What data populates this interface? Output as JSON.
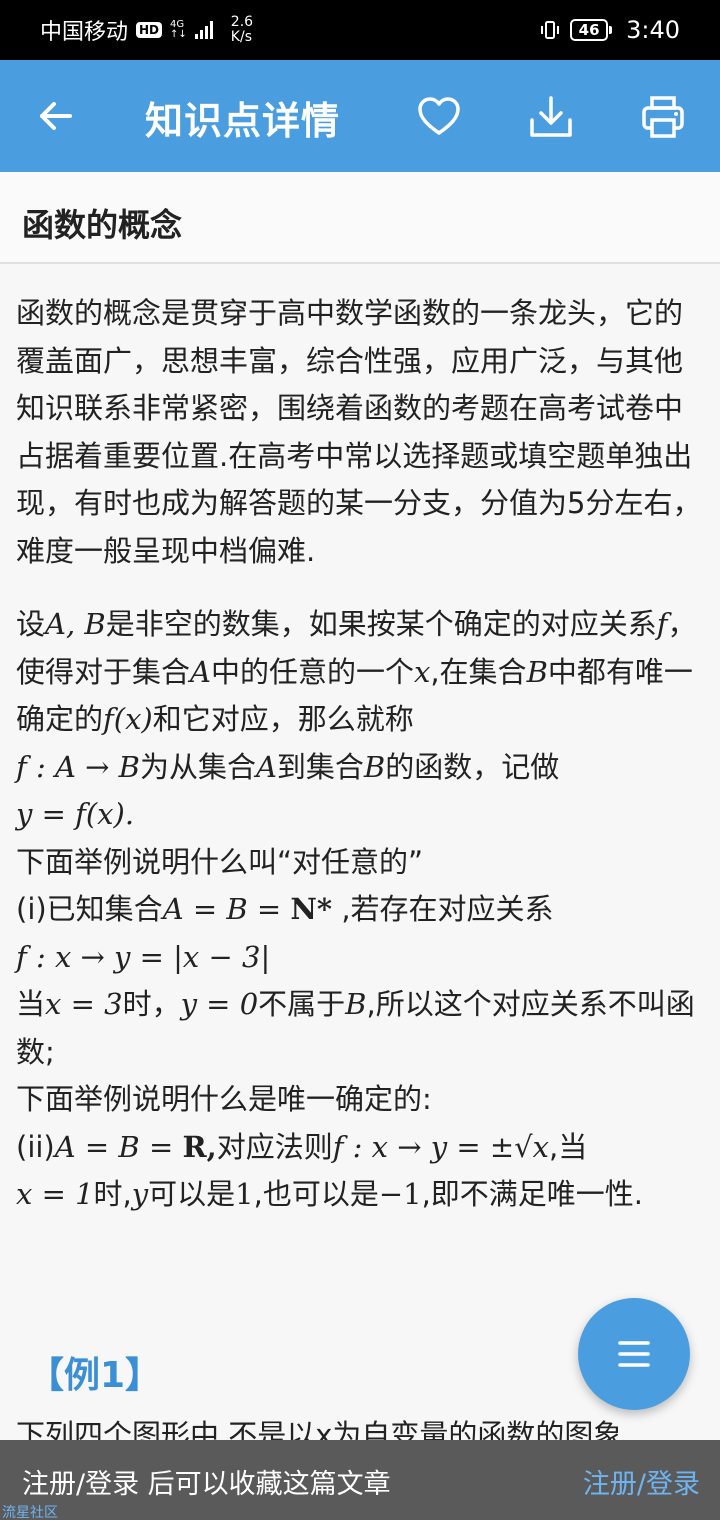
{
  "status_bar": {
    "carrier": "中国移动",
    "hd": "HD",
    "net_type_top": "4G",
    "net_type_bottom": "↑↓",
    "speed_value": "2.6",
    "speed_unit": "K/s",
    "battery": "46",
    "time": "3:40"
  },
  "app_bar": {
    "title": "知识点详情"
  },
  "section": {
    "title": "函数的概念"
  },
  "content": {
    "intro": "函数的概念是贯穿于高中数学函数的一条龙头，它的覆盖面广，思想丰富，综合性强，应用广泛，与其他知识联系非常紧密，围绕着函数的考题在高考试卷中占据着重要位置.在高考中常以选择题或填空题单独出现，有时也成为解答题的某一分支，分值为5分左右，难度一般呈现中档偏难.",
    "def_1": "设",
    "def_m1": "A, B",
    "def_2": "是非空的数集，如果按某个确定的对应关系",
    "def_m2": "f",
    "def_3": "，使得对于集合",
    "def_m3": "A",
    "def_4": "中的任意的一个",
    "def_m4": "x",
    "def_5": ",在集合",
    "def_m5": "B",
    "def_6": "中都有唯一确定的",
    "def_m6": "f(x)",
    "def_7": "和它对应，那么就称",
    "def_m7": "f : A → B",
    "def_8": "为从集合",
    "def_m8": "A",
    "def_9": "到集合",
    "def_m9": "B",
    "def_10": "的函数，记做",
    "def_m10": "y = f(x).",
    "ex_any_intro": "下面举例说明什么叫“对任意的”",
    "ex_i_1": "(i)已知集合",
    "ex_i_m1": "A = B = ",
    "ex_i_m1b": "N*",
    "ex_i_2": " ,若存在对应关系",
    "ex_i_m2": "f : x → y = |x − 3|",
    "ex_i_3": "当",
    "ex_i_m3": "x = 3",
    "ex_i_4": "时，",
    "ex_i_m4": "y = 0",
    "ex_i_5": "不属于",
    "ex_i_m5": "B",
    "ex_i_6": ",所以这个对应关系不叫函数;",
    "ex_unique_intro": "下面举例说明什么是唯一确定的:",
    "ex_ii_1": "(ii)",
    "ex_ii_m1": "A = B = ",
    "ex_ii_m1b": "R,",
    "ex_ii_2": "对应法则",
    "ex_ii_m2": "f : x → y = ±√x",
    "ex_ii_3": ",当",
    "ex_ii_m3": "x = 1",
    "ex_ii_4": "时,",
    "ex_ii_m4": "y",
    "ex_ii_5": "可以是",
    "ex_ii_m5": "1",
    "ex_ii_6": ",也可以是",
    "ex_ii_m6": "−1",
    "ex_ii_7": ",即不满足唯一性.",
    "example_title": "【例1】",
    "cut_line": "下列四个图形中,不是以x为自变量的函数的图象"
  },
  "bottom_bar": {
    "message": "注册/登录 后可以收藏这篇文章",
    "login": "注册/登录"
  },
  "watermark": "流星社区",
  "icons": {
    "back": "arrow-left-icon",
    "favorite": "heart-icon",
    "download": "download-icon",
    "print": "printer-icon",
    "menu": "menu-icon"
  },
  "colors": {
    "primary": "#4a9ee0",
    "accent_text": "#3a8fd6",
    "bottom_bar": "#5a5a5a",
    "login_link": "#6fb4f0"
  }
}
